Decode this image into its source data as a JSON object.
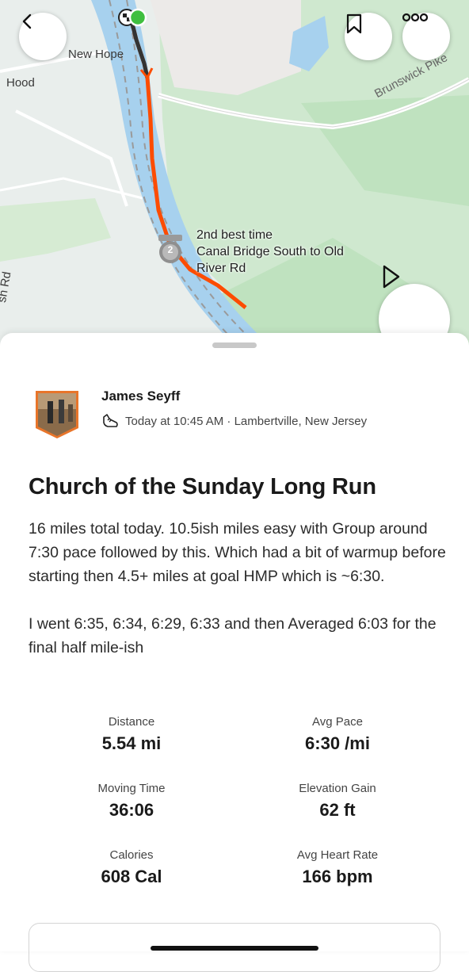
{
  "map": {
    "labels": {
      "new_hope": "New Hope",
      "hood": "Hood",
      "brunswick_pike": "Brunswick Pike",
      "road_fragment": "sh Rd"
    },
    "segment": {
      "badge_rank": "2",
      "line1": "2nd best time",
      "line2": "Canal Bridge South to Old",
      "line3": "River Rd"
    },
    "route_color": "#fc4c02"
  },
  "header": {
    "back_icon": "chevron-left-icon",
    "bookmark_icon": "bookmark-icon",
    "more_icon": "more-icon",
    "play_icon": "play-icon"
  },
  "activity": {
    "athlete_name": "James Seyff",
    "sport_icon": "shoe-icon",
    "meta": "Today at 10:45 AM · Lambertville, New Jersey",
    "title": "Church of the Sunday Long Run",
    "description_1": "16 miles total today. 10.5ish miles easy with Group around 7:30 pace followed by this. Which had a bit of warmup before starting then 4.5+ miles at goal HMP which is ~6:30.",
    "description_2": "I went 6:35, 6:34, 6:29, 6:33 and then Averaged 6:03 for the final half mile-ish"
  },
  "stats": [
    {
      "label": "Distance",
      "value": "5.54 mi"
    },
    {
      "label": "Avg Pace",
      "value": "6:30 /mi"
    },
    {
      "label": "Moving Time",
      "value": "36:06"
    },
    {
      "label": "Elevation Gain",
      "value": "62 ft"
    },
    {
      "label": "Calories",
      "value": "608 Cal"
    },
    {
      "label": "Avg Heart Rate",
      "value": "166 bpm"
    }
  ]
}
